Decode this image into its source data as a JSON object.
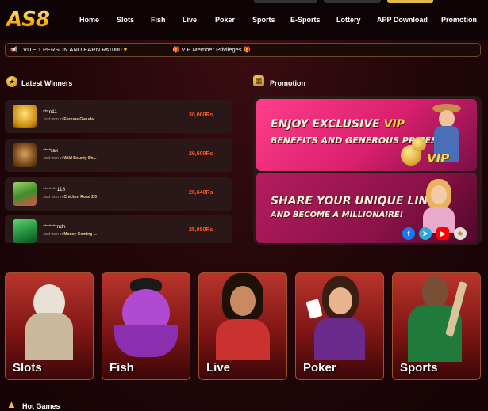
{
  "header": {
    "logo": "AS8",
    "nav": [
      "Home",
      "Slots",
      "Fish",
      "Live",
      "Poker",
      "Sports",
      "E-Sports",
      "Lottery",
      "APP Download",
      "Promotion"
    ]
  },
  "marquee": {
    "text1": "VITE 1 PERSON AND EARN ₨1000",
    "text2": "VIP Member Privileges"
  },
  "winners": {
    "title": "Latest Winners",
    "items": [
      {
        "user": "***n11",
        "prefix": "Just won in",
        "game": "Fortune Garuda ...",
        "amount": "30,000Rs"
      },
      {
        "user": "****rak",
        "prefix": "Just won in",
        "game": "Wild Bounty Sh...",
        "amount": "29,600Rs"
      },
      {
        "user": "*******118",
        "prefix": "Just won in",
        "game": "Chicken Road 2.0",
        "amount": "26,640Rs"
      },
      {
        "user": "*******ndh",
        "prefix": "Just won in",
        "game": "Money Coming ...",
        "amount": "25,050Rs"
      }
    ]
  },
  "promotion": {
    "title": "Promotion",
    "banner1": {
      "line1a": "ENJOY EXCLUSIVE ",
      "line1b": "VIP",
      "line2": "BENEFITS AND GENEROUS PRIZES!",
      "badge": "VIP"
    },
    "banner2": {
      "line1": "SHARE YOUR UNIQUE LINK",
      "line2": "AND BECOME A MILLIONAIRE!"
    }
  },
  "categories": [
    "Slots",
    "Fish",
    "Live",
    "Poker",
    "Sports"
  ],
  "hot_games": {
    "title": "Hot Games"
  },
  "colors": {
    "accent": "#ffb31a",
    "amount": "#ff5a2a",
    "card": "#2a1718",
    "promo_pink": "#e0246f"
  }
}
